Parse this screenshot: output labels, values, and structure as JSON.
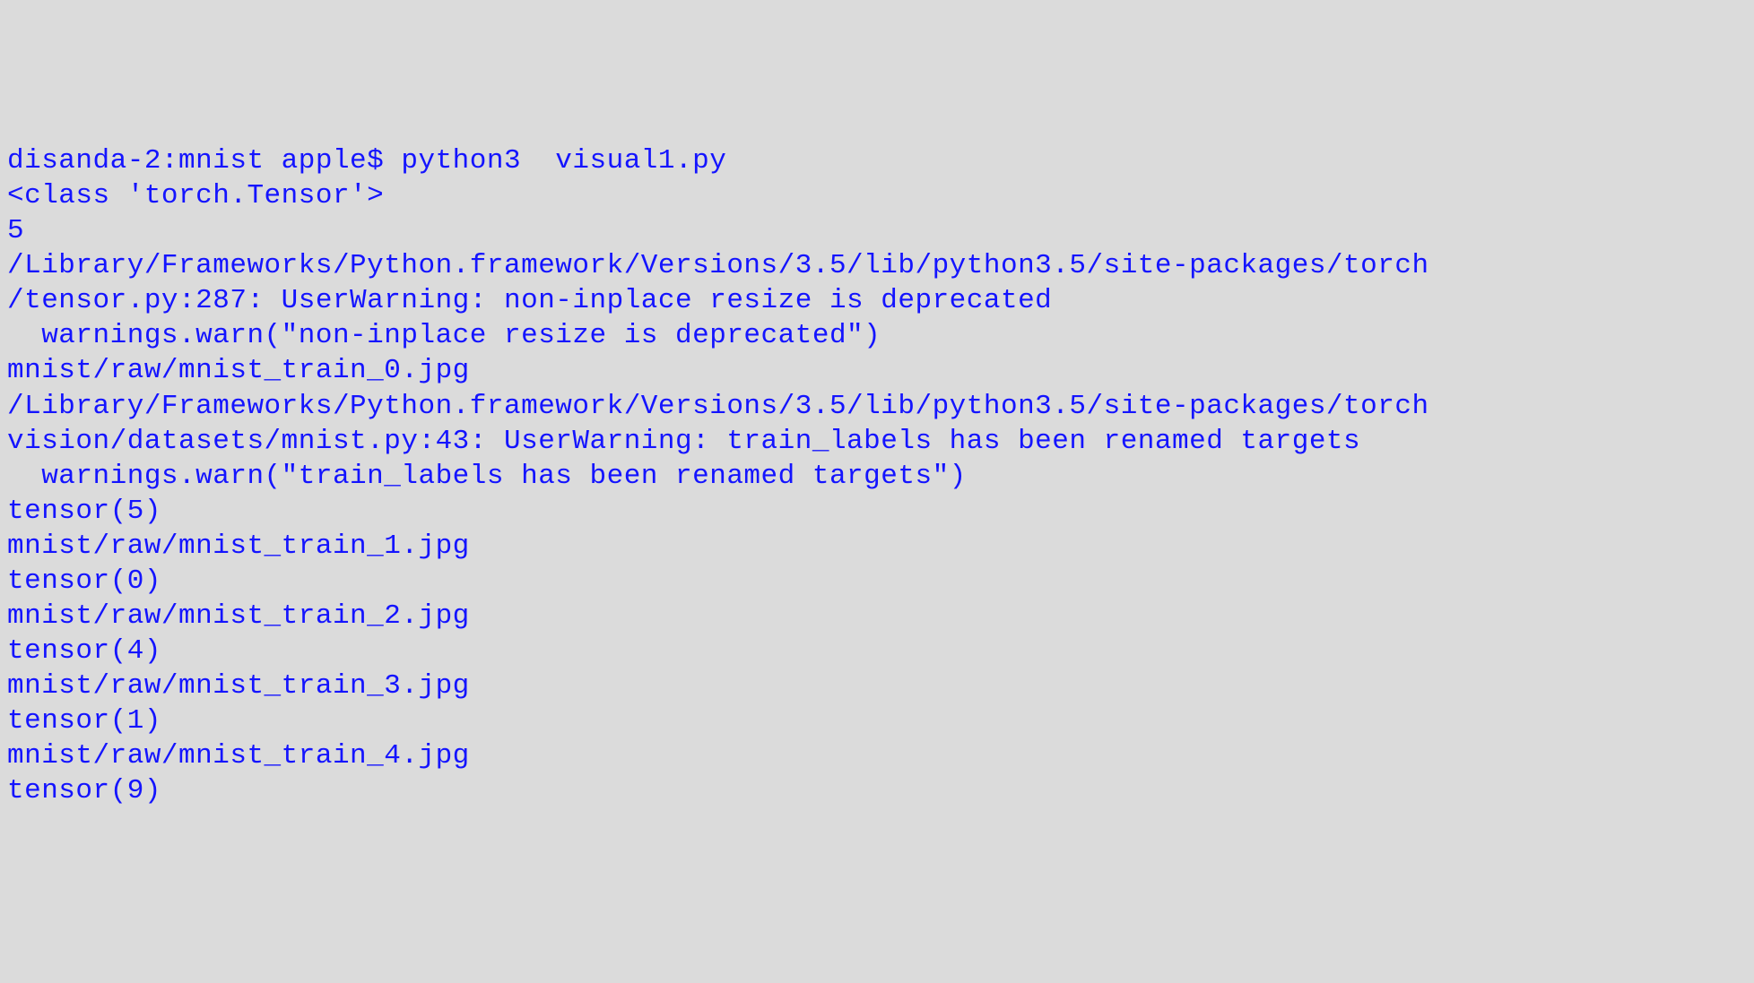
{
  "terminal": {
    "lines": [
      "disanda-2:mnist apple$ python3  visual1.py",
      "<class 'torch.Tensor'>",
      "5",
      "/Library/Frameworks/Python.framework/Versions/3.5/lib/python3.5/site-packages/torch",
      "/tensor.py:287: UserWarning: non-inplace resize is deprecated",
      "  warnings.warn(\"non-inplace resize is deprecated\")",
      "mnist/raw/mnist_train_0.jpg",
      "/Library/Frameworks/Python.framework/Versions/3.5/lib/python3.5/site-packages/torch",
      "vision/datasets/mnist.py:43: UserWarning: train_labels has been renamed targets",
      "  warnings.warn(\"train_labels has been renamed targets\")",
      "tensor(5)",
      "mnist/raw/mnist_train_1.jpg",
      "tensor(0)",
      "mnist/raw/mnist_train_2.jpg",
      "tensor(4)",
      "mnist/raw/mnist_train_3.jpg",
      "tensor(1)",
      "mnist/raw/mnist_train_4.jpg",
      "tensor(9)"
    ]
  }
}
